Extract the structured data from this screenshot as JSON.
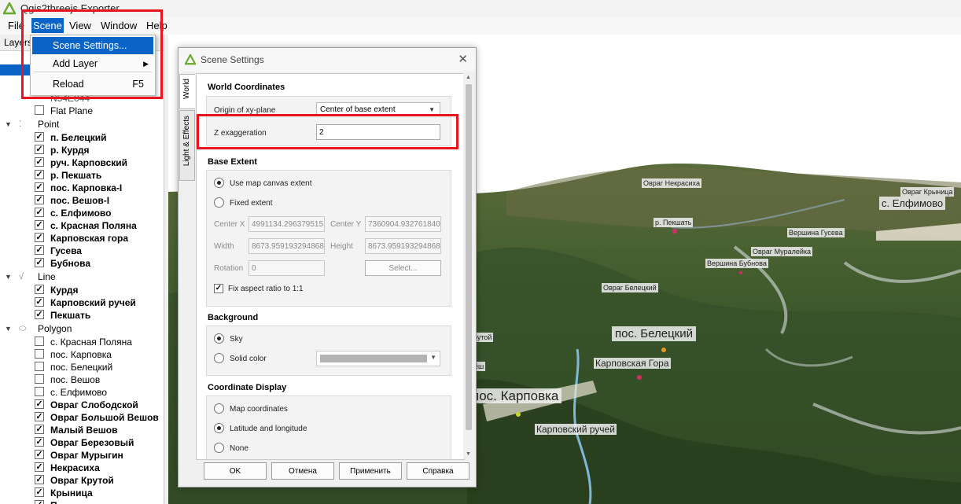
{
  "window": {
    "title": "Qgis2threejs Exporter"
  },
  "menubar": {
    "file": "File",
    "scene": "Scene",
    "view": "View",
    "window": "Window",
    "help": "Help"
  },
  "scene_menu": {
    "scene_settings": "Scene Settings...",
    "add_layer": "Add Layer",
    "reload": "Reload",
    "reload_shortcut": "F5"
  },
  "layers_panel": {
    "title": "Layers",
    "hidden_row": "N54E044",
    "flat_plane": "Flat Plane",
    "point_group": "Point",
    "points": [
      "п. Белецкий",
      "р. Курдя",
      "руч. Карповский",
      "р. Пекшать",
      "пос. Карповка-I",
      "пос. Вешов-I",
      "с. Елфимово",
      "с. Красная Поляна",
      "Карповская гора",
      "Гусева",
      "Бубнова"
    ],
    "line_group": "Line",
    "lines": [
      "Курдя",
      "Карповский ручей",
      "Пекшать"
    ],
    "polygon_group": "Polygon",
    "polygons_unchecked": [
      "с. Красная Поляна",
      "пос. Карповка",
      "пос. Белецкий",
      "пос. Вешов",
      "с. Елфимово"
    ],
    "polygons_checked": [
      "Овраг Слободской",
      "Овраг Большой Вешов",
      "Малый Вешов",
      "Овраг Березовый",
      "Овраг Мурыгин",
      "Некрасиха",
      "Овраг Крутой",
      "Крыница",
      "П..."
    ]
  },
  "map_labels": {
    "ovrag_nekrasikha": "Овраг Некрасиха",
    "ovrag_krynitsa": "Овраг Крыница",
    "elfimovo": "с. Елфимово",
    "pekshat": "р. Пекшать",
    "gusev": "Вершина Гусева",
    "muraleyka": "Овраг Муралейка",
    "bubnova": "Вершина Бубнова",
    "beletsky_ovrag": "Овраг Белецкий",
    "krutoy": "рутой",
    "pos_beletsky": "пос. Белецкий",
    "karpovskaya_gora": "Карповская Гора",
    "pos_karpovka": "пос. Карповка",
    "karpovsky_ruchey": "Карповский ручей",
    "vesh": "ёш"
  },
  "dialog": {
    "title": "Scene Settings",
    "tabs": {
      "world": "World",
      "light": "Light & Effects"
    },
    "world_coordinates": {
      "title": "World Coordinates",
      "origin_label": "Origin of xy-plane",
      "origin_value": "Center of base extent",
      "z_label": "Z exaggeration",
      "z_value": "2"
    },
    "base_extent": {
      "title": "Base Extent",
      "use_map": "Use map canvas extent",
      "fixed": "Fixed extent",
      "center_x_label": "Center X",
      "center_x": "4991134.296379515",
      "center_y_label": "Center Y",
      "center_y": "7360904.932761840",
      "width_label": "Width",
      "width": "8673.959193294868",
      "height_label": "Height",
      "height": "8673.959193294868",
      "rotation_label": "Rotation",
      "rotation": "0",
      "select_btn": "Select...",
      "fix_aspect": "Fix aspect ratio to 1:1"
    },
    "background": {
      "title": "Background",
      "sky": "Sky",
      "solid": "Solid color"
    },
    "coordinate_display": {
      "title": "Coordinate Display",
      "map_coords": "Map coordinates",
      "latlon": "Latitude and longitude",
      "none": "None"
    },
    "buttons": {
      "ok": "OK",
      "cancel": "Отмена",
      "apply": "Применить",
      "help": "Справка"
    }
  },
  "colors": {
    "accent": "#0a64c8",
    "highlight": "#e8141e"
  }
}
